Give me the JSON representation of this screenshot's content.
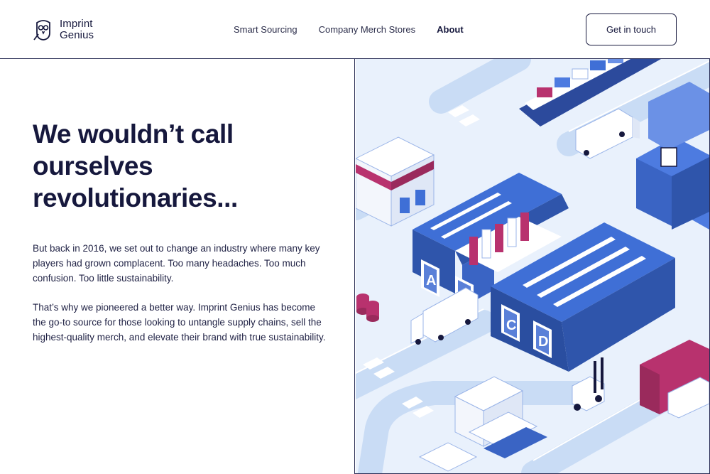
{
  "brand": {
    "line1": "Imprint",
    "line2": "Genius",
    "icon": "owl-logo-icon"
  },
  "nav": {
    "items": [
      {
        "label": "Smart Sourcing",
        "active": false
      },
      {
        "label": "Company Merch Stores",
        "active": false
      },
      {
        "label": "About",
        "active": true
      }
    ]
  },
  "cta": {
    "label": "Get in touch"
  },
  "hero": {
    "headline_line1": "We wouldn’t call",
    "headline_line2": "ourselves",
    "headline_line3": "revolutionaries...",
    "paragraph1": "But back in 2016, we set out to change an industry where many key players had grown complacent. Too many headaches. Too much confusion. Too little sustainability.",
    "paragraph2": "That’s why we pioneered a better way. Imprint Genius has become the go-to source for those looking to untangle supply chains, sell the highest-quality merch, and elevate their brand with true sustainability."
  },
  "illustration": {
    "dock_labels": [
      "A",
      "B",
      "C",
      "D"
    ],
    "colors": {
      "primary_blue": "#3f6fd6",
      "magenta": "#b8326e",
      "navy": "#16183d",
      "road": "#c9dcf5",
      "ground": "#e9f1fc"
    }
  }
}
